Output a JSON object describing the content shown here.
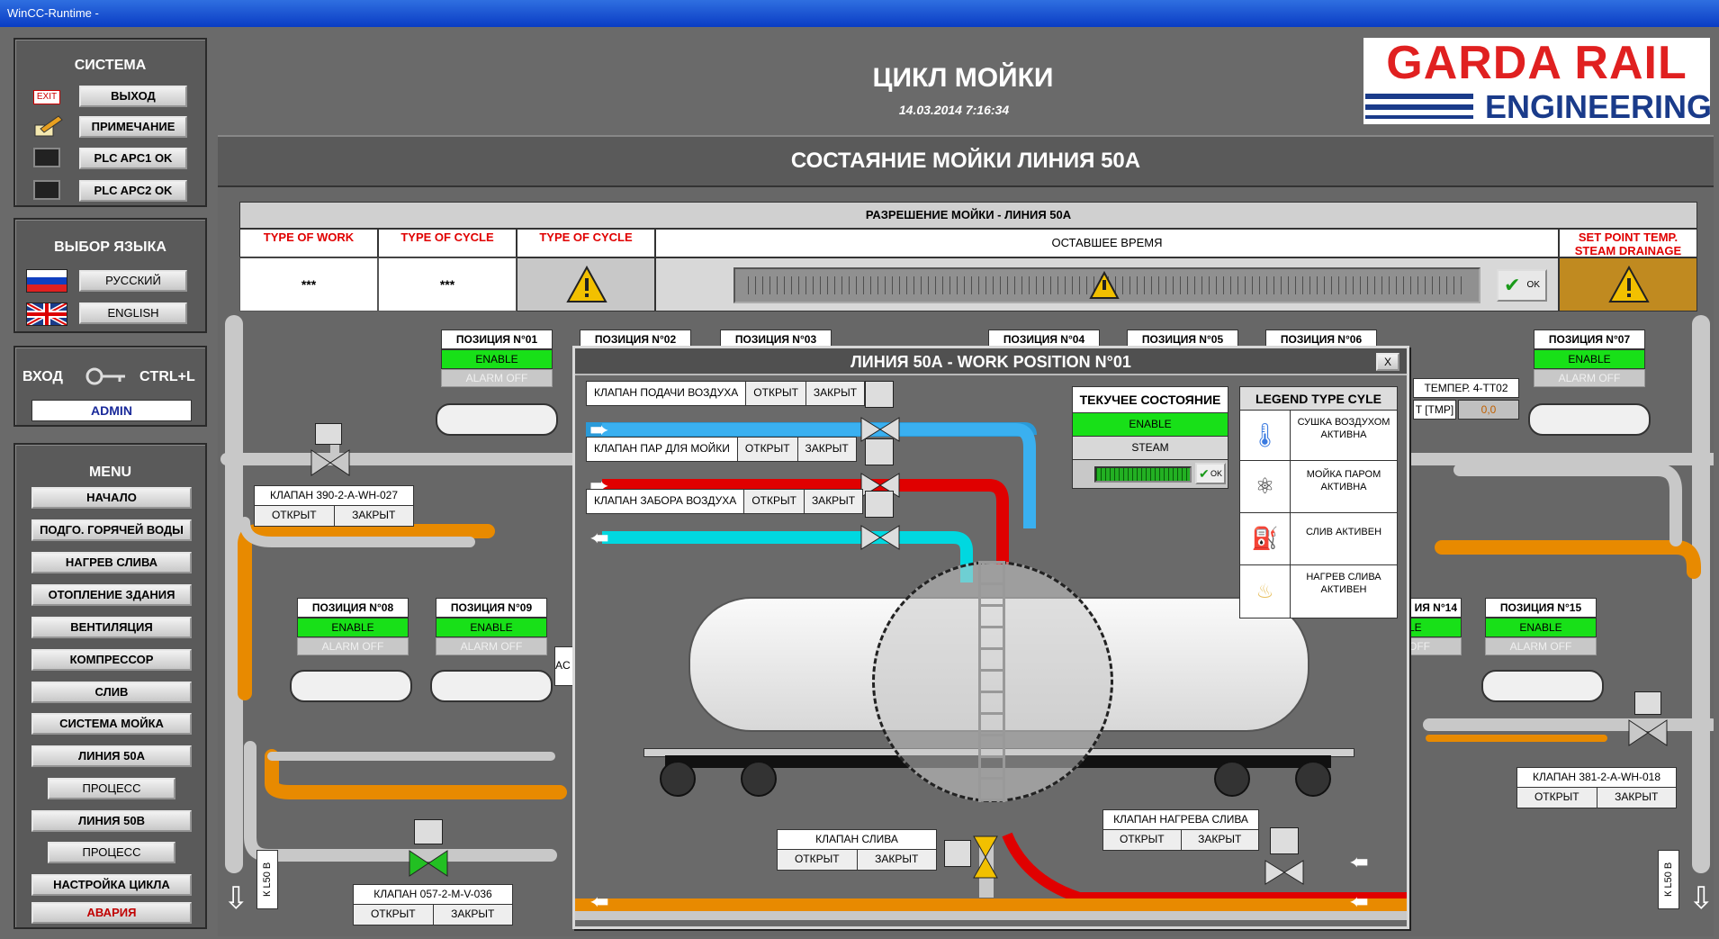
{
  "window_title": "WinCC-Runtime -",
  "system": {
    "title": "СИСТЕМА",
    "exit_badge": "EXIT",
    "buttons": [
      "ВЫХОД",
      "ПРИМЕЧАНИЕ",
      "PLC APC1 OK",
      "PLC APC2 OK"
    ]
  },
  "language": {
    "title": "ВЫБОР ЯЗЫКА",
    "options": [
      "РУССКИЙ",
      "ENGLISH"
    ]
  },
  "login": {
    "label": "ВХОД",
    "shortcut": "CTRL+L",
    "user": "ADMIN"
  },
  "menu": {
    "title": "MENU",
    "items": [
      "НАЧАЛО",
      "ПОДГО. ГОРЯЧЕЙ ВОДЫ",
      "НАГРЕВ СЛИВА",
      "ОТОПЛЕНИЕ ЗДАНИЯ",
      "ВЕНТИЛЯЦИЯ",
      "КОМПРЕССОР",
      "СЛИВ",
      "СИСТЕМА МОЙКА",
      "ЛИНИЯ 50А",
      "ПРОЦЕСС",
      "ЛИНИЯ 50В",
      "ПРОЦЕСС",
      "НАСТРОЙКА ЦИКЛА",
      "АВАРИЯ"
    ]
  },
  "header": {
    "title": "ЦИКЛ МОЙКИ",
    "datetime": "14.03.2014 7:16:34",
    "logo_line1": "GARDA RAIL",
    "logo_line2": "ENGINEERING"
  },
  "section_title": "СОСТАЯНИЕ МОЙКИ ЛИНИЯ 50А",
  "permission": {
    "title": "РАЗРЕШЕНИЕ МОЙКИ - ЛИНИЯ 50А",
    "col1": "TYPE OF WORK",
    "col2": "TYPE OF CYCLE",
    "col3": "TYPE OF CYCLE",
    "col4": "ОСТАВШЕЕ ВРЕМЯ",
    "col5": "SET POINT TEMP. STEAM DRAINAGE",
    "val1": "***",
    "val2": "***",
    "ok": "OK"
  },
  "positions": {
    "p01": {
      "title": "ПОЗИЦИЯ N°01",
      "status": "ENABLE",
      "alarm": "ALARM OFF"
    },
    "p02": {
      "title": "ПОЗИЦИЯ N°02"
    },
    "p03": {
      "title": "ПОЗИЦИЯ N°03"
    },
    "p04": {
      "title": "ПОЗИЦИЯ N°04"
    },
    "p05": {
      "title": "ПОЗИЦИЯ N°05"
    },
    "p06": {
      "title": "ПОЗИЦИЯ N°06"
    },
    "p07": {
      "title": "ПОЗИЦИЯ N°07",
      "status": "ENABLE",
      "alarm": "ALARM OFF"
    },
    "p08": {
      "title": "ПОЗИЦИЯ N°08",
      "status": "ENABLE",
      "alarm": "ALARM OFF"
    },
    "p09": {
      "title": "ПОЗИЦИЯ N°09",
      "status": "ENABLE",
      "alarm": "ALARM OFF"
    },
    "p14": {
      "title": "ИЯ N°14",
      "status": "LE",
      "alarm": "OFF"
    },
    "p15": {
      "title": "ПОЗИЦИЯ N°15",
      "status": "ENABLE",
      "alarm": "ALARM OFF"
    }
  },
  "valves": {
    "v027": {
      "name": "КЛАПАН 390-2-А-WH-027",
      "open": "ОТКРЫТ",
      "close": "ЗАКРЫТ"
    },
    "v036": {
      "name": "КЛАПАН 057-2-М-V-036",
      "open": "ОТКРЫТ",
      "close": "ЗАКРЫТ"
    },
    "v018": {
      "name": "КЛАПАН 381-2-А-WH-018",
      "open": "ОТКРЫТ",
      "close": "ЗАКРЫТ"
    }
  },
  "temp": {
    "label": "ТЕМПЕР. 4-TT02",
    "unit": "T [TMP]",
    "value": "0,0"
  },
  "side_labels": {
    "left": "К L50 B",
    "right": "К L50 B",
    "partial": "AC"
  },
  "popup": {
    "title": "ЛИНИЯ 50А - WORK POSITION N°01",
    "close": "X",
    "valve_air_in": {
      "name": "КЛАПАН ПОДАЧИ ВОЗДУХА",
      "open": "ОТКРЫТ",
      "close": "ЗАКРЫТ"
    },
    "valve_steam": {
      "name": "КЛАПАН ПАР ДЛЯ МОЙКИ",
      "open": "ОТКРЫТ",
      "close": "ЗАКРЫТ"
    },
    "valve_air_out": {
      "name": "КЛАПАН ЗАБОРА ВОЗДУХА",
      "open": "ОТКРЫТ",
      "close": "ЗАКРЫТ"
    },
    "state": {
      "title": "ТЕКУЧЕЕ СОСТОЯНИЕ",
      "status": "ENABLE",
      "mode": "STEAM",
      "ok": "OK"
    },
    "legend": {
      "title": "LEGEND TYPE CYLE",
      "items": [
        "СУШКА ВОЗДУХОМ АКТИВНА",
        "МОЙКА ПАРОМ АКТИВНА",
        "СЛИВ АКТИВЕН",
        "НАГРЕВ СЛИВА АКТИВЕН"
      ]
    },
    "valve_drain": {
      "name": "КЛАПАН СЛИВА",
      "open": "ОТКРЫТ",
      "close": "ЗАКРЫТ"
    },
    "valve_drain_heat": {
      "name": "КЛАПАН НАГРЕВА СЛИВА",
      "open": "ОТКРЫТ",
      "close": "ЗАКРЫТ"
    }
  },
  "colors": {
    "enable": "#18e018",
    "air": "#3ab0f0",
    "steam": "#e00000",
    "air_out": "#00d8e0",
    "hot_water": "#e88a00",
    "pipe": "#c8c8c8"
  }
}
